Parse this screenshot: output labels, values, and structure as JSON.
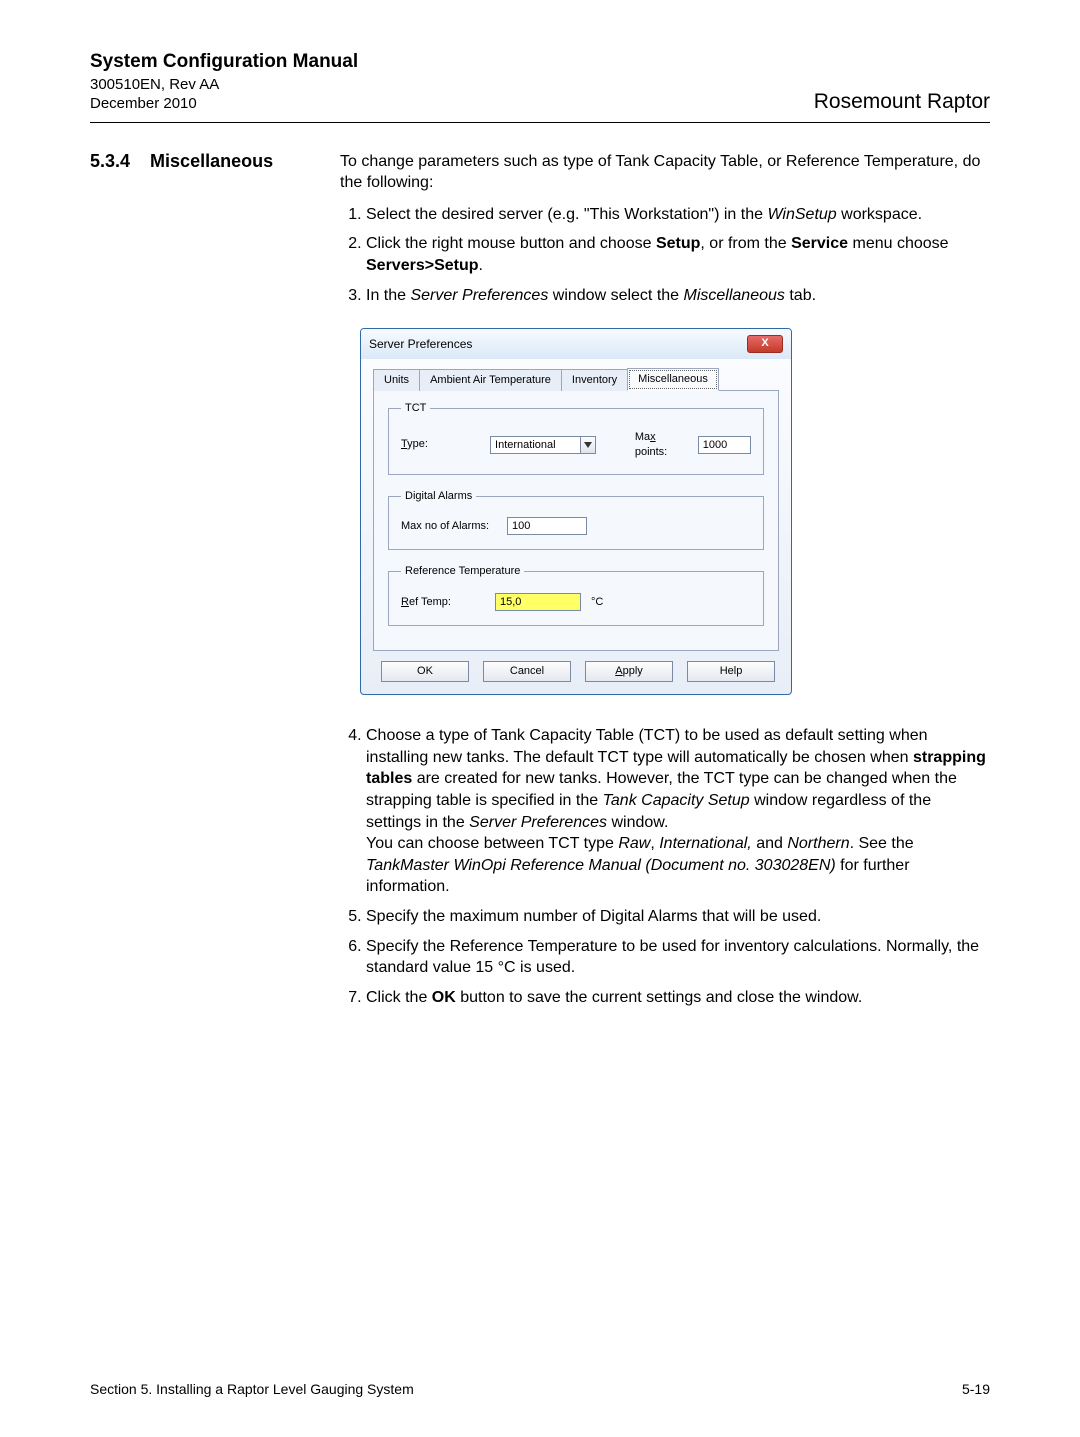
{
  "header": {
    "doc_title": "System Configuration Manual",
    "doc_number": "300510EN, Rev AA",
    "doc_date": "December 2010",
    "brand": "Rosemount Raptor"
  },
  "section": {
    "number": "5.3.4",
    "title": "Miscellaneous"
  },
  "intro": "To change parameters such as type of Tank Capacity Table, or Reference Temperature, do the following:",
  "steps": {
    "s1a": "Select the desired server (e.g. \"This Workstation\") in the ",
    "s1b": "WinSetup",
    "s1c": " workspace.",
    "s2a": "Click the right mouse button and choose ",
    "s2b": "Setup",
    "s2c": ", or from the ",
    "s2d": "Service",
    "s2e": " menu choose ",
    "s2f": "Servers>Setup",
    "s2g": ".",
    "s3a": "In the ",
    "s3b": "Server Preferences",
    "s3c": " window select the ",
    "s3d": "Miscellaneous",
    "s3e": " tab.",
    "s4a": "Choose a type of Tank Capacity Table (TCT) to be used as default setting when installing new tanks. The default TCT type will automatically be chosen when ",
    "s4b": "strapping tables",
    "s4c": " are created for new tanks. However, the TCT type can be changed when the strapping table is specified in the ",
    "s4d": "Tank Capacity Setup",
    "s4e": " window regardless of the settings in the ",
    "s4f": "Server Preferences",
    "s4g": " window.",
    "s4h": "You can choose between TCT type ",
    "s4i": "Raw",
    "s4j": ", ",
    "s4k": "International,",
    "s4l": " and ",
    "s4m": "Northern",
    "s4n": ". See the ",
    "s4o": "TankMaster WinOpi Reference Manual (Document no. 303028EN)",
    "s4p": " for further information.",
    "s5": "Specify the maximum number of Digital Alarms that will be used.",
    "s6": "Specify the Reference Temperature to be used for inventory calculations. Normally, the standard value 15 °C is used.",
    "s7a": "Click the ",
    "s7b": "OK",
    "s7c": " button to save the current settings and close the window."
  },
  "dialog": {
    "title": "Server Preferences",
    "close": "X",
    "tabs": {
      "units": "Units",
      "ambient": "Ambient Air Temperature",
      "inventory": "Inventory",
      "misc": "Miscellaneous"
    },
    "tct": {
      "legend": "TCT",
      "type_label_pre": "T",
      "type_label_post": "ype:",
      "type_value": "International",
      "maxpoints_label_pre": "Ma",
      "maxpoints_label_ul": "x",
      "maxpoints_label_post": " points:",
      "maxpoints_value": "1000"
    },
    "alarms": {
      "legend": "Digital Alarms",
      "label": "Max no of Alarms:",
      "value": "100"
    },
    "reftemp": {
      "legend": "Reference Temperature",
      "label_ul": "R",
      "label_post": "ef Temp:",
      "value": "15,0",
      "unit": "°C"
    },
    "buttons": {
      "ok": "OK",
      "cancel": "Cancel",
      "apply_ul": "A",
      "apply_post": "pply",
      "help": "Help"
    }
  },
  "footer": {
    "left": "Section 5. Installing a Raptor Level Gauging System",
    "right": "5-19"
  }
}
